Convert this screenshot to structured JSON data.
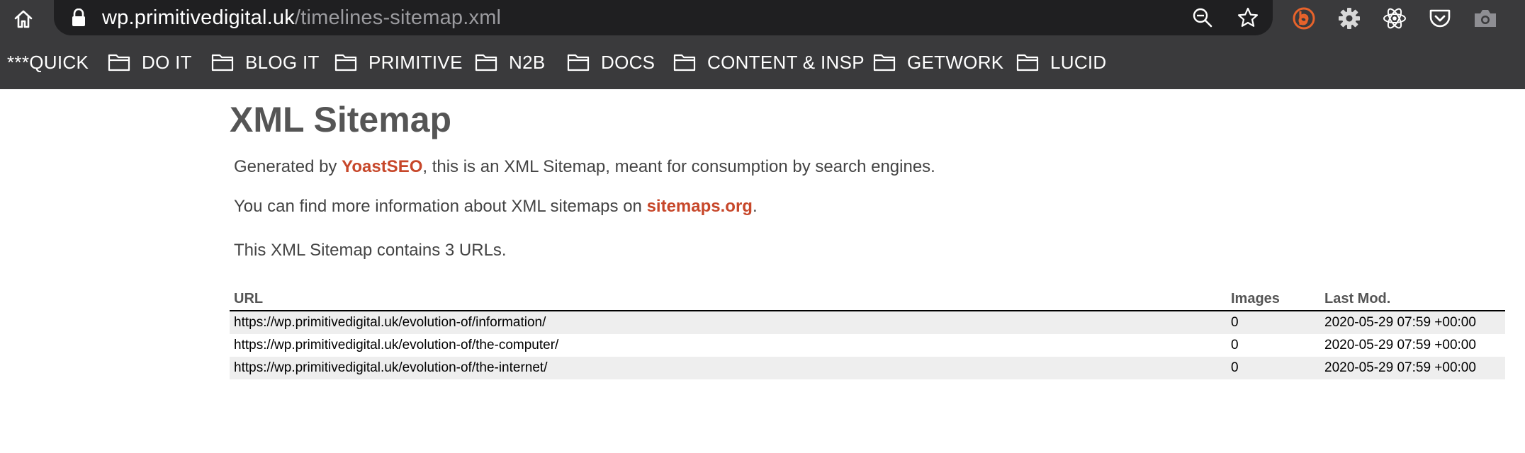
{
  "browser": {
    "url_domain": "wp.primitivedigital.uk",
    "url_path": "/timelines-sitemap.xml",
    "icons": {
      "home": "home-icon",
      "lock": "lock-icon",
      "zoom": "zoom-out-icon",
      "bookmark_star": "star-icon",
      "extensions": [
        "brave-b-icon",
        "gear-icon",
        "react-atom-icon",
        "pocket-icon",
        "camera-icon"
      ]
    },
    "colors": {
      "toolbar": "#3a3a3c",
      "urlbar": "#1f1f21",
      "accent": "#e8632b"
    }
  },
  "bookmarks": [
    {
      "label": "***QUICK",
      "folder": false
    },
    {
      "label": "DO IT",
      "folder": true
    },
    {
      "label": "BLOG IT",
      "folder": true
    },
    {
      "label": "PRIMITIVE",
      "folder": true
    },
    {
      "label": "N2B",
      "folder": true
    },
    {
      "label": "DOCS",
      "folder": true
    },
    {
      "label": "CONTENT & INSP",
      "folder": true
    },
    {
      "label": "GETWORK",
      "folder": true
    },
    {
      "label": "LUCID",
      "folder": true
    }
  ],
  "page": {
    "title": "XML Sitemap",
    "generated_prefix": "Generated by ",
    "generated_link": "YoastSEO",
    "generated_suffix": ", this is an XML Sitemap, meant for consumption by search engines.",
    "info_prefix": "You can find more information about XML sitemaps on ",
    "info_link": "sitemaps.org",
    "info_suffix": ".",
    "count_text": "This XML Sitemap contains 3 URLs.",
    "link_color": "#c7472a"
  },
  "table": {
    "headers": [
      "URL",
      "Images",
      "Last Mod."
    ],
    "rows": [
      {
        "url": "https://wp.primitivedigital.uk/evolution-of/information/",
        "images": "0",
        "last_mod": "2020-05-29 07:59 +00:00"
      },
      {
        "url": "https://wp.primitivedigital.uk/evolution-of/the-computer/",
        "images": "0",
        "last_mod": "2020-05-29 07:59 +00:00"
      },
      {
        "url": "https://wp.primitivedigital.uk/evolution-of/the-internet/",
        "images": "0",
        "last_mod": "2020-05-29 07:59 +00:00"
      }
    ]
  }
}
